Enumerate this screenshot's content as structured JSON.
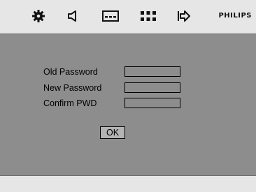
{
  "menu": {
    "icons": [
      "settings-gear-icon",
      "speaker-audio-icon",
      "subtitle-display-icon",
      "grid-menu-icon",
      "exit-arrow-icon"
    ],
    "brand": "PHILIPS"
  },
  "form": {
    "old_password_label": "Old Password",
    "new_password_label": "New Password",
    "confirm_label": "Confirm PWD",
    "old_password_value": "",
    "new_password_value": "",
    "confirm_value": "",
    "ok_label": "OK"
  },
  "colors": {
    "menu_bar": "#e6e6e6",
    "screen_background": "#8d8d8d",
    "ok_button": "#b4b4b4"
  }
}
